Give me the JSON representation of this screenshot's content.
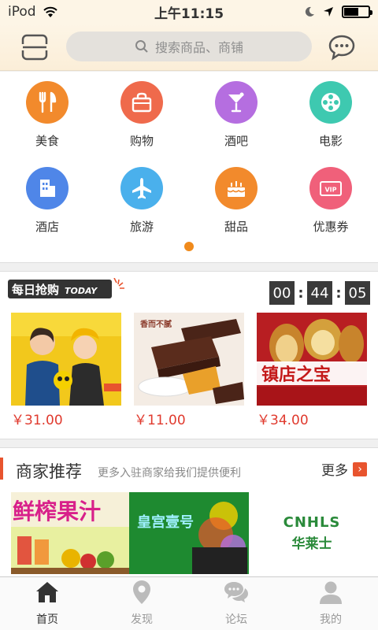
{
  "status_bar": {
    "carrier": "iPod",
    "time": "上午11:15"
  },
  "header": {
    "search_placeholder": "搜索商品、商铺"
  },
  "categories": [
    {
      "label": "美食",
      "icon": "utensils-icon",
      "color": "#f28a2c"
    },
    {
      "label": "购物",
      "icon": "shopping-bag-icon",
      "color": "#ef6a4c"
    },
    {
      "label": "酒吧",
      "icon": "cocktail-icon",
      "color": "#b56ee0"
    },
    {
      "label": "电影",
      "icon": "film-reel-icon",
      "color": "#3ec9b0"
    },
    {
      "label": "酒店",
      "icon": "building-icon",
      "color": "#4f86e8"
    },
    {
      "label": "旅游",
      "icon": "airplane-icon",
      "color": "#4ab0ec"
    },
    {
      "label": "甜品",
      "icon": "cake-icon",
      "color": "#f28a2c"
    },
    {
      "label": "优惠券",
      "icon": "vip-coupon-icon",
      "color": "#f0607a"
    }
  ],
  "flash_sale": {
    "title": "每日抢购",
    "title_badge": "TODAY",
    "timer": {
      "hours": "00",
      "minutes": "44",
      "seconds": "05"
    },
    "products": [
      {
        "price": "￥31.00"
      },
      {
        "price": "￥11.00",
        "label": "香而不腻"
      },
      {
        "price": "￥34.00",
        "label": "镇店之宝"
      }
    ]
  },
  "merchant": {
    "title": "商家推荐",
    "subtitle": "更多入驻商家给我们提供便利",
    "more": "更多",
    "banners": [
      {
        "text": "鲜榨果汁"
      },
      {
        "text": "皇宫壹号"
      },
      {
        "text_en": "CNHLS",
        "text_cn": "华莱士"
      }
    ]
  },
  "tabs": [
    {
      "label": "首页",
      "icon": "home-icon",
      "active": true
    },
    {
      "label": "发现",
      "icon": "location-pin-icon",
      "active": false
    },
    {
      "label": "论坛",
      "icon": "chat-bubbles-icon",
      "active": false
    },
    {
      "label": "我的",
      "icon": "user-icon",
      "active": false
    }
  ]
}
